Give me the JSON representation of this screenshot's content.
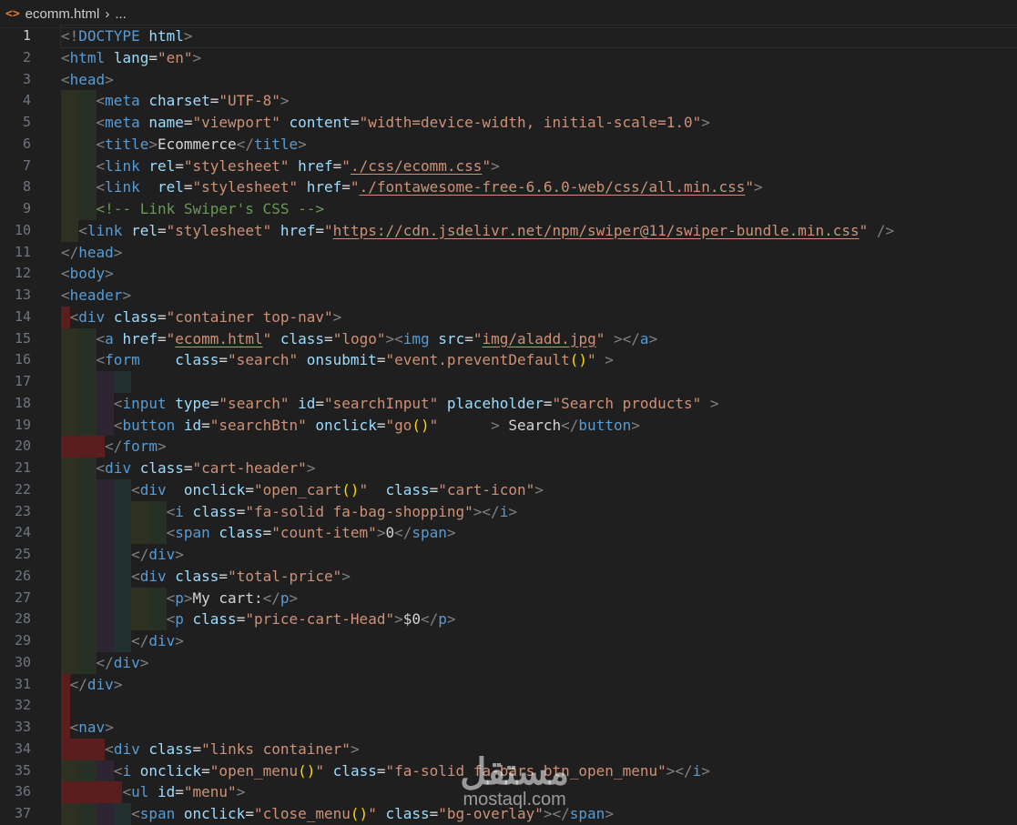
{
  "breadcrumb": {
    "file": "ecomm.html",
    "more": "..."
  },
  "editor": {
    "current_line": 1,
    "lines": [
      [
        [
          "p",
          "<!"
        ],
        [
          "n",
          "DOCTYPE"
        ],
        [
          "x",
          " "
        ],
        [
          "a",
          "html"
        ],
        [
          "p",
          ">"
        ]
      ],
      [
        [
          "p",
          "<"
        ],
        [
          "n",
          "html"
        ],
        [
          "x",
          " "
        ],
        [
          "a",
          "lang"
        ],
        [
          "x",
          "="
        ],
        [
          "s",
          "\"en\""
        ],
        [
          "p",
          ">"
        ]
      ],
      [
        [
          "p",
          "<"
        ],
        [
          "n",
          "head"
        ],
        [
          "p",
          ">"
        ]
      ],
      [
        [
          "x",
          "    "
        ],
        [
          "p",
          "<"
        ],
        [
          "n",
          "meta"
        ],
        [
          "x",
          " "
        ],
        [
          "a",
          "charset"
        ],
        [
          "x",
          "="
        ],
        [
          "s",
          "\"UTF-8\""
        ],
        [
          "p",
          ">"
        ]
      ],
      [
        [
          "x",
          "    "
        ],
        [
          "p",
          "<"
        ],
        [
          "n",
          "meta"
        ],
        [
          "x",
          " "
        ],
        [
          "a",
          "name"
        ],
        [
          "x",
          "="
        ],
        [
          "s",
          "\"viewport\""
        ],
        [
          "x",
          " "
        ],
        [
          "a",
          "content"
        ],
        [
          "x",
          "="
        ],
        [
          "s",
          "\"width=device-width, initial-scale=1.0\""
        ],
        [
          "p",
          ">"
        ]
      ],
      [
        [
          "x",
          "    "
        ],
        [
          "p",
          "<"
        ],
        [
          "n",
          "title"
        ],
        [
          "p",
          ">"
        ],
        [
          "x",
          "Ecommerce"
        ],
        [
          "p",
          "</"
        ],
        [
          "n",
          "title"
        ],
        [
          "p",
          ">"
        ]
      ],
      [
        [
          "x",
          "    "
        ],
        [
          "p",
          "<"
        ],
        [
          "n",
          "link"
        ],
        [
          "x",
          " "
        ],
        [
          "a",
          "rel"
        ],
        [
          "x",
          "="
        ],
        [
          "s",
          "\"stylesheet\""
        ],
        [
          "x",
          " "
        ],
        [
          "a",
          "href"
        ],
        [
          "x",
          "="
        ],
        [
          "s",
          "\""
        ],
        [
          "u",
          "./css/ecomm.css"
        ],
        [
          "s",
          "\""
        ],
        [
          "p",
          ">"
        ]
      ],
      [
        [
          "x",
          "    "
        ],
        [
          "p",
          "<"
        ],
        [
          "n",
          "link"
        ],
        [
          "x",
          "  "
        ],
        [
          "a",
          "rel"
        ],
        [
          "x",
          "="
        ],
        [
          "s",
          "\"stylesheet\""
        ],
        [
          "x",
          " "
        ],
        [
          "a",
          "href"
        ],
        [
          "x",
          "="
        ],
        [
          "s",
          "\""
        ],
        [
          "u",
          "./fontawesome-free-6.6.0-web/css/all.min.css"
        ],
        [
          "s",
          "\""
        ],
        [
          "p",
          ">"
        ]
      ],
      [
        [
          "x",
          "    "
        ],
        [
          "c",
          "<!-- Link Swiper's CSS -->"
        ]
      ],
      [
        [
          "x",
          "  "
        ],
        [
          "p",
          "<"
        ],
        [
          "n",
          "link"
        ],
        [
          "x",
          " "
        ],
        [
          "a",
          "rel"
        ],
        [
          "x",
          "="
        ],
        [
          "s",
          "\"stylesheet\""
        ],
        [
          "x",
          " "
        ],
        [
          "a",
          "href"
        ],
        [
          "x",
          "="
        ],
        [
          "s",
          "\""
        ],
        [
          "u",
          "https://cdn.jsdelivr.net/npm/swiper@11/swiper-bundle.min.css"
        ],
        [
          "s",
          "\""
        ],
        [
          "x",
          " "
        ],
        [
          "p",
          "/>"
        ]
      ],
      [
        [
          "p",
          "</"
        ],
        [
          "n",
          "head"
        ],
        [
          "p",
          ">"
        ]
      ],
      [
        [
          "p",
          "<"
        ],
        [
          "n",
          "body"
        ],
        [
          "p",
          ">"
        ]
      ],
      [
        [
          "p",
          "<"
        ],
        [
          "n",
          "header"
        ],
        [
          "p",
          ">"
        ]
      ],
      [
        [
          "x",
          " "
        ],
        [
          "p",
          "<"
        ],
        [
          "n",
          "div"
        ],
        [
          "x",
          " "
        ],
        [
          "a",
          "class"
        ],
        [
          "x",
          "="
        ],
        [
          "s",
          "\"container top-nav\""
        ],
        [
          "p",
          ">"
        ]
      ],
      [
        [
          "x",
          "    "
        ],
        [
          "p",
          "<"
        ],
        [
          "n",
          "a"
        ],
        [
          "x",
          " "
        ],
        [
          "a",
          "href"
        ],
        [
          "x",
          "="
        ],
        [
          "s",
          "\""
        ],
        [
          "u",
          "ecomm.html"
        ],
        [
          "s",
          "\""
        ],
        [
          "x",
          " "
        ],
        [
          "a",
          "class"
        ],
        [
          "x",
          "="
        ],
        [
          "s",
          "\"logo\""
        ],
        [
          "p",
          "><"
        ],
        [
          "n",
          "img"
        ],
        [
          "x",
          " "
        ],
        [
          "a",
          "src"
        ],
        [
          "x",
          "="
        ],
        [
          "s",
          "\""
        ],
        [
          "u",
          "img/aladd.jpg"
        ],
        [
          "s",
          "\""
        ],
        [
          "x",
          " "
        ],
        [
          "p",
          "></"
        ],
        [
          "n",
          "a"
        ],
        [
          "p",
          ">"
        ]
      ],
      [
        [
          "x",
          "    "
        ],
        [
          "p",
          "<"
        ],
        [
          "n",
          "form"
        ],
        [
          "x",
          "    "
        ],
        [
          "a",
          "class"
        ],
        [
          "x",
          "="
        ],
        [
          "s",
          "\"search\""
        ],
        [
          "x",
          " "
        ],
        [
          "a",
          "onsubmit"
        ],
        [
          "x",
          "="
        ],
        [
          "s",
          "\"event.preventDefault"
        ],
        [
          "y",
          "()"
        ],
        [
          "s",
          "\""
        ],
        [
          "x",
          " "
        ],
        [
          "p",
          ">"
        ]
      ],
      [
        [
          "x",
          "        "
        ]
      ],
      [
        [
          "x",
          "      "
        ],
        [
          "p",
          "<"
        ],
        [
          "n",
          "input"
        ],
        [
          "x",
          " "
        ],
        [
          "a",
          "type"
        ],
        [
          "x",
          "="
        ],
        [
          "s",
          "\"search\""
        ],
        [
          "x",
          " "
        ],
        [
          "a",
          "id"
        ],
        [
          "x",
          "="
        ],
        [
          "s",
          "\"searchInput\""
        ],
        [
          "x",
          " "
        ],
        [
          "a",
          "placeholder"
        ],
        [
          "x",
          "="
        ],
        [
          "s",
          "\"Search products\""
        ],
        [
          "x",
          " "
        ],
        [
          "p",
          ">"
        ]
      ],
      [
        [
          "x",
          "      "
        ],
        [
          "p",
          "<"
        ],
        [
          "n",
          "button"
        ],
        [
          "x",
          " "
        ],
        [
          "a",
          "id"
        ],
        [
          "x",
          "="
        ],
        [
          "s",
          "\"searchBtn\""
        ],
        [
          "x",
          " "
        ],
        [
          "a",
          "onclick"
        ],
        [
          "x",
          "="
        ],
        [
          "s",
          "\"go"
        ],
        [
          "y",
          "()"
        ],
        [
          "s",
          "\""
        ],
        [
          "x",
          "      "
        ],
        [
          "p",
          ">"
        ],
        [
          "x",
          " Search"
        ],
        [
          "p",
          "</"
        ],
        [
          "n",
          "button"
        ],
        [
          "p",
          ">"
        ]
      ],
      [
        [
          "x",
          "     "
        ],
        [
          "p",
          "</"
        ],
        [
          "n",
          "form"
        ],
        [
          "p",
          ">"
        ]
      ],
      [
        [
          "x",
          "    "
        ],
        [
          "p",
          "<"
        ],
        [
          "n",
          "div"
        ],
        [
          "x",
          " "
        ],
        [
          "a",
          "class"
        ],
        [
          "x",
          "="
        ],
        [
          "s",
          "\"cart-header\""
        ],
        [
          "p",
          ">"
        ]
      ],
      [
        [
          "x",
          "        "
        ],
        [
          "p",
          "<"
        ],
        [
          "n",
          "div"
        ],
        [
          "x",
          "  "
        ],
        [
          "a",
          "onclick"
        ],
        [
          "x",
          "="
        ],
        [
          "s",
          "\"open_cart"
        ],
        [
          "y",
          "()"
        ],
        [
          "s",
          "\""
        ],
        [
          "x",
          "  "
        ],
        [
          "a",
          "class"
        ],
        [
          "x",
          "="
        ],
        [
          "s",
          "\"cart-icon\""
        ],
        [
          "p",
          ">"
        ]
      ],
      [
        [
          "x",
          "            "
        ],
        [
          "p",
          "<"
        ],
        [
          "n",
          "i"
        ],
        [
          "x",
          " "
        ],
        [
          "a",
          "class"
        ],
        [
          "x",
          "="
        ],
        [
          "s",
          "\"fa-solid fa-bag-shopping\""
        ],
        [
          "p",
          "></"
        ],
        [
          "n",
          "i"
        ],
        [
          "p",
          ">"
        ]
      ],
      [
        [
          "x",
          "            "
        ],
        [
          "p",
          "<"
        ],
        [
          "n",
          "span"
        ],
        [
          "x",
          " "
        ],
        [
          "a",
          "class"
        ],
        [
          "x",
          "="
        ],
        [
          "s",
          "\"count-item\""
        ],
        [
          "p",
          ">"
        ],
        [
          "x",
          "0"
        ],
        [
          "p",
          "</"
        ],
        [
          "n",
          "span"
        ],
        [
          "p",
          ">"
        ]
      ],
      [
        [
          "x",
          "        "
        ],
        [
          "p",
          "</"
        ],
        [
          "n",
          "div"
        ],
        [
          "p",
          ">"
        ]
      ],
      [
        [
          "x",
          "        "
        ],
        [
          "p",
          "<"
        ],
        [
          "n",
          "div"
        ],
        [
          "x",
          " "
        ],
        [
          "a",
          "class"
        ],
        [
          "x",
          "="
        ],
        [
          "s",
          "\"total-price\""
        ],
        [
          "p",
          ">"
        ]
      ],
      [
        [
          "x",
          "            "
        ],
        [
          "p",
          "<"
        ],
        [
          "n",
          "p"
        ],
        [
          "p",
          ">"
        ],
        [
          "x",
          "My cart:"
        ],
        [
          "p",
          "</"
        ],
        [
          "n",
          "p"
        ],
        [
          "p",
          ">"
        ]
      ],
      [
        [
          "x",
          "            "
        ],
        [
          "p",
          "<"
        ],
        [
          "n",
          "p"
        ],
        [
          "x",
          " "
        ],
        [
          "a",
          "class"
        ],
        [
          "x",
          "="
        ],
        [
          "s",
          "\"price-cart-Head\""
        ],
        [
          "p",
          ">"
        ],
        [
          "x",
          "$0"
        ],
        [
          "p",
          "</"
        ],
        [
          "n",
          "p"
        ],
        [
          "p",
          ">"
        ]
      ],
      [
        [
          "x",
          "        "
        ],
        [
          "p",
          "</"
        ],
        [
          "n",
          "div"
        ],
        [
          "p",
          ">"
        ]
      ],
      [
        [
          "x",
          "    "
        ],
        [
          "p",
          "</"
        ],
        [
          "n",
          "div"
        ],
        [
          "p",
          ">"
        ]
      ],
      [
        [
          "x",
          " "
        ],
        [
          "p",
          "</"
        ],
        [
          "n",
          "div"
        ],
        [
          "p",
          ">"
        ]
      ],
      [
        [
          "x",
          " "
        ]
      ],
      [
        [
          "x",
          " "
        ],
        [
          "p",
          "<"
        ],
        [
          "n",
          "nav"
        ],
        [
          "p",
          ">"
        ]
      ],
      [
        [
          "x",
          "     "
        ],
        [
          "p",
          "<"
        ],
        [
          "n",
          "div"
        ],
        [
          "x",
          " "
        ],
        [
          "a",
          "class"
        ],
        [
          "x",
          "="
        ],
        [
          "s",
          "\"links container\""
        ],
        [
          "p",
          ">"
        ]
      ],
      [
        [
          "x",
          "      "
        ],
        [
          "p",
          "<"
        ],
        [
          "n",
          "i"
        ],
        [
          "x",
          " "
        ],
        [
          "a",
          "onclick"
        ],
        [
          "x",
          "="
        ],
        [
          "s",
          "\"open_menu"
        ],
        [
          "y",
          "()"
        ],
        [
          "s",
          "\""
        ],
        [
          "x",
          " "
        ],
        [
          "a",
          "class"
        ],
        [
          "x",
          "="
        ],
        [
          "s",
          "\"fa-solid fa-bars btn_open_menu\""
        ],
        [
          "p",
          "></"
        ],
        [
          "n",
          "i"
        ],
        [
          "p",
          ">"
        ]
      ],
      [
        [
          "x",
          "       "
        ],
        [
          "p",
          "<"
        ],
        [
          "n",
          "ul"
        ],
        [
          "x",
          " "
        ],
        [
          "a",
          "id"
        ],
        [
          "x",
          "="
        ],
        [
          "s",
          "\"menu\""
        ],
        [
          "p",
          ">"
        ]
      ],
      [
        [
          "x",
          "        "
        ],
        [
          "p",
          "<"
        ],
        [
          "n",
          "span"
        ],
        [
          "x",
          " "
        ],
        [
          "a",
          "onclick"
        ],
        [
          "x",
          "="
        ],
        [
          "s",
          "\"close_menu"
        ],
        [
          "y",
          "()"
        ],
        [
          "s",
          "\""
        ],
        [
          "x",
          " "
        ],
        [
          "a",
          "class"
        ],
        [
          "x",
          "="
        ],
        [
          "s",
          "\"bg-overlay\""
        ],
        [
          "p",
          "></"
        ],
        [
          "n",
          "span"
        ],
        [
          "p",
          ">"
        ]
      ]
    ]
  },
  "watermark": {
    "arabic": "مستقل",
    "latin": "mostaql.com"
  }
}
